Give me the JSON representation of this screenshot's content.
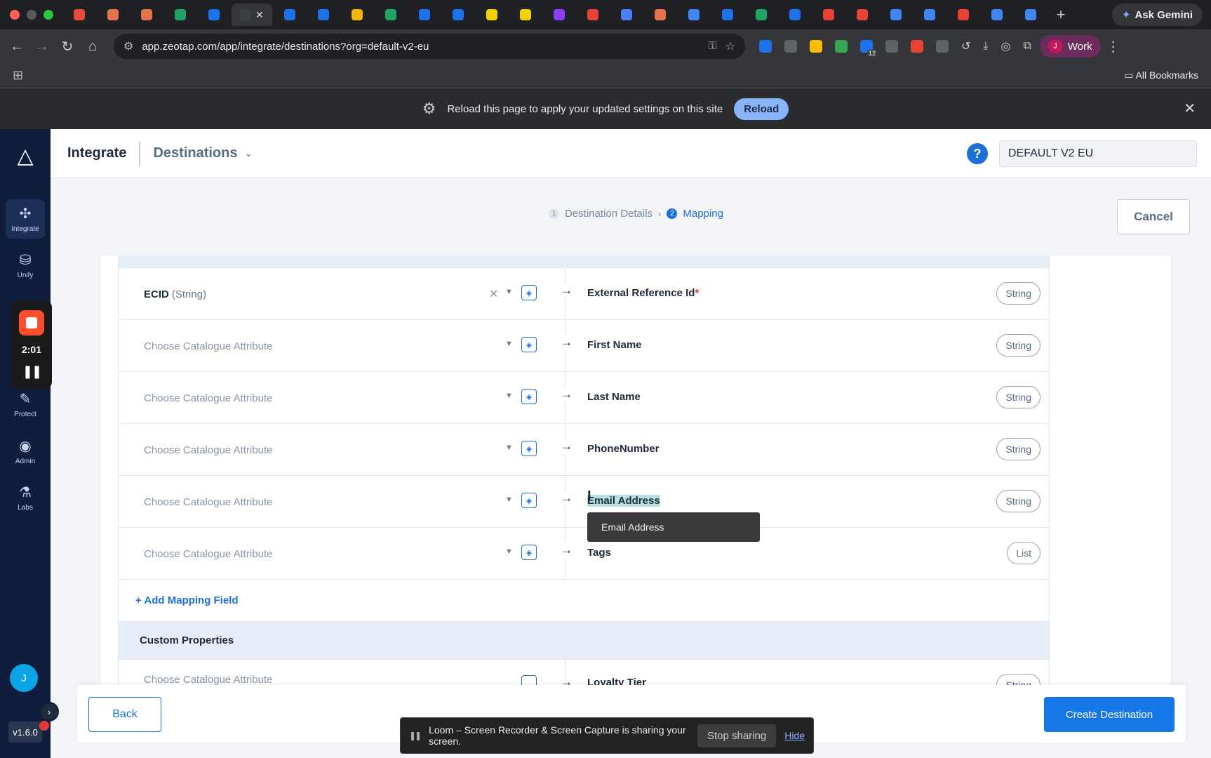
{
  "browser": {
    "url": "app.zeotap.com/app/integrate/destinations?org=default-v2-eu",
    "ask_gemini": "Ask Gemini",
    "profile_initial": "J",
    "profile_label": "Work",
    "all_bookmarks": "All Bookmarks",
    "traffic_colors": [
      "#ff5f57",
      "#5a5a5a",
      "#28c840"
    ],
    "tab_colors": [
      "#e64a3b",
      "#e8734a",
      "#e8734a",
      "#21a464",
      "#1a73e8",
      "#3c4043",
      "#1a73e8",
      "#1a73e8",
      "#f5b400",
      "#21a464",
      "#1a73e8",
      "#1a73e8",
      "#f5d000",
      "#f5d000",
      "#8b3dff",
      "#ea4335",
      "#4a7ff5",
      "#e8734a",
      "#4285f4",
      "#1a73e8",
      "#21a464",
      "#1a73e8",
      "#ea4335",
      "#ea4335",
      "#4285f4",
      "#4285f4",
      "#ea4335",
      "#4285f4",
      "#4285f4"
    ],
    "ext_colors": [
      "#1a73e8",
      "#5f6368",
      "#fbbc04",
      "#34a853",
      "#1a73e8",
      "#5f6368",
      "#ea4335",
      "#5f6368"
    ],
    "ext_badge": "12"
  },
  "reload_banner": {
    "message": "Reload this page to apply your updated settings on this site",
    "button": "Reload"
  },
  "sidebar": {
    "items": [
      {
        "label": "Integrate",
        "icon": "integrate-icon"
      },
      {
        "label": "Unify",
        "icon": "database-icon"
      },
      {
        "label": "Protect",
        "icon": "protect-icon"
      },
      {
        "label": "Admin",
        "icon": "admin-icon"
      },
      {
        "label": "Labs",
        "icon": "flask-icon"
      }
    ],
    "loom_timer": "2:01",
    "user_initial": "J",
    "version": "v1.6.0"
  },
  "header": {
    "title": "Integrate",
    "section": "Destinations",
    "org": "DEFAULT V2 EU",
    "help": "?"
  },
  "steps": {
    "step1_num": "1",
    "step1_label": "Destination Details",
    "step2_num": "2",
    "step2_label": "Mapping",
    "cancel": "Cancel"
  },
  "mapping": {
    "rows": [
      {
        "source_name": "ECID",
        "source_type": "(String)",
        "placeholder": "",
        "dest": "External Reference Id",
        "required": "*",
        "type": "String"
      },
      {
        "source_name": "",
        "source_type": "",
        "placeholder": "Choose Catalogue Attribute",
        "dest": "First Name",
        "required": "",
        "type": "String"
      },
      {
        "source_name": "",
        "source_type": "",
        "placeholder": "Choose Catalogue Attribute",
        "dest": "Last Name",
        "required": "",
        "type": "String"
      },
      {
        "source_name": "",
        "source_type": "",
        "placeholder": "Choose Catalogue Attribute",
        "dest": "PhoneNumber",
        "required": "",
        "type": "String"
      },
      {
        "source_name": "",
        "source_type": "",
        "placeholder": "Choose Catalogue Attribute",
        "dest": "Email Address",
        "required": "",
        "type": "String"
      },
      {
        "source_name": "",
        "source_type": "",
        "placeholder": "Choose Catalogue Attribute",
        "dest": "Tags",
        "required": "",
        "type": "List"
      }
    ],
    "tooltip": "Email Address",
    "add_field": "+ Add Mapping Field",
    "custom_properties": "Custom Properties",
    "partial_row": {
      "placeholder": "Choose Catalogue Attribute",
      "dest": "Loyalty Tier",
      "type": "String"
    }
  },
  "footer": {
    "back": "Back",
    "create": "Create Destination"
  },
  "loom": {
    "message": "Loom – Screen Recorder & Screen Capture is sharing your screen.",
    "stop": "Stop sharing",
    "hide": "Hide"
  }
}
